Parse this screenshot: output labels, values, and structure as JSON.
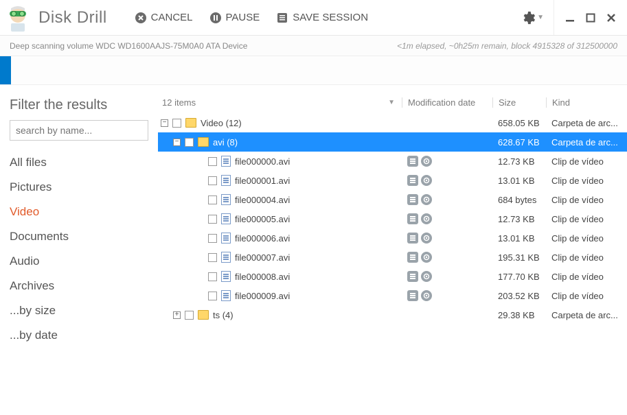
{
  "app": {
    "title": "Disk Drill"
  },
  "toolbar": {
    "cancel": "CANCEL",
    "pause": "PAUSE",
    "save_session": "SAVE SESSION"
  },
  "status": {
    "left": "Deep scanning volume WDC WD1600AAJS-75M0A0 ATA Device",
    "right": "<1m elapsed, ~0h25m remain, block 4915328 of 312500000"
  },
  "sidebar": {
    "title": "Filter the results",
    "search_placeholder": "search by name...",
    "filters": [
      "All files",
      "Pictures",
      "Video",
      "Documents",
      "Audio",
      "Archives",
      "...by size",
      "...by date"
    ],
    "active_index": 2
  },
  "columns": {
    "items_label": "12 items",
    "date": "Modification date",
    "size": "Size",
    "kind": "Kind"
  },
  "rows": [
    {
      "type": "folder",
      "indent": 0,
      "expander": "minus",
      "name": "Video (12)",
      "size": "658.05 KB",
      "kind": "Carpeta de arc...",
      "selected": false
    },
    {
      "type": "folder",
      "indent": 1,
      "expander": "minus",
      "name": "avi (8)",
      "size": "628.67 KB",
      "kind": "Carpeta de arc...",
      "selected": true
    },
    {
      "type": "file",
      "indent": 2,
      "expander": "",
      "name": "file000000.avi",
      "size": "12.73 KB",
      "kind": "Clip de vídeo",
      "selected": false,
      "actions": true
    },
    {
      "type": "file",
      "indent": 2,
      "expander": "",
      "name": "file000001.avi",
      "size": "13.01 KB",
      "kind": "Clip de vídeo",
      "selected": false,
      "actions": true
    },
    {
      "type": "file",
      "indent": 2,
      "expander": "",
      "name": "file000004.avi",
      "size": "684 bytes",
      "kind": "Clip de vídeo",
      "selected": false,
      "actions": true
    },
    {
      "type": "file",
      "indent": 2,
      "expander": "",
      "name": "file000005.avi",
      "size": "12.73 KB",
      "kind": "Clip de vídeo",
      "selected": false,
      "actions": true
    },
    {
      "type": "file",
      "indent": 2,
      "expander": "",
      "name": "file000006.avi",
      "size": "13.01 KB",
      "kind": "Clip de vídeo",
      "selected": false,
      "actions": true
    },
    {
      "type": "file",
      "indent": 2,
      "expander": "",
      "name": "file000007.avi",
      "size": "195.31 KB",
      "kind": "Clip de vídeo",
      "selected": false,
      "actions": true
    },
    {
      "type": "file",
      "indent": 2,
      "expander": "",
      "name": "file000008.avi",
      "size": "177.70 KB",
      "kind": "Clip de vídeo",
      "selected": false,
      "actions": true
    },
    {
      "type": "file",
      "indent": 2,
      "expander": "",
      "name": "file000009.avi",
      "size": "203.52 KB",
      "kind": "Clip de vídeo",
      "selected": false,
      "actions": true
    },
    {
      "type": "folder",
      "indent": 1,
      "expander": "plus",
      "name": "ts (4)",
      "size": "29.38 KB",
      "kind": "Carpeta de arc...",
      "selected": false
    }
  ]
}
